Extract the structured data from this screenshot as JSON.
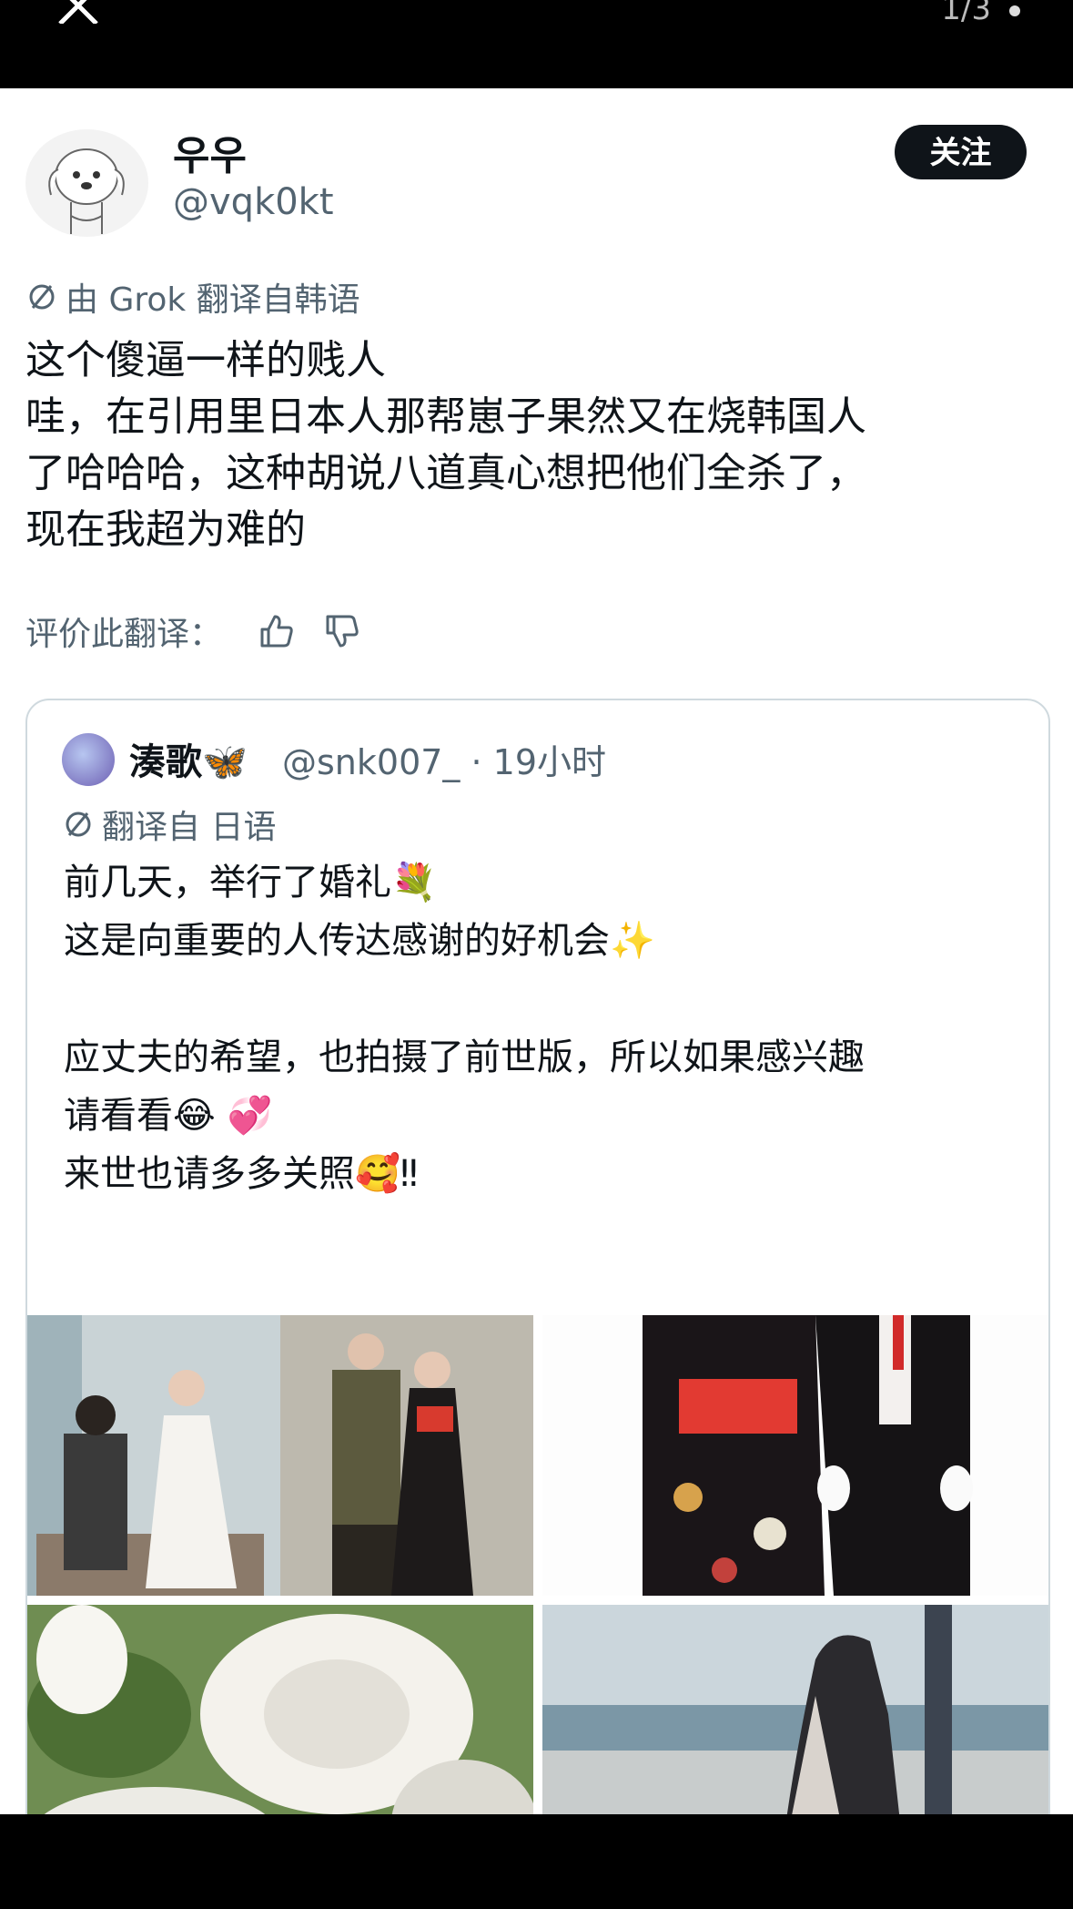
{
  "viewer": {
    "counter": "1/3"
  },
  "author": {
    "display_name": "우우",
    "handle": "@vqk0kt",
    "follow_label": "关注"
  },
  "translation_note": "由 Grok 翻译自韩语",
  "post_lines": [
    "这个傻逼一样的贱人",
    "哇，在引用里日本人那帮崽子果然又在烧韩国人",
    "了哈哈哈，这种胡说八道真心想把他们全杀了，",
    "现在我超为难的"
  ],
  "rate_label": "评价此翻译：",
  "quote": {
    "display_name": "湊歌🦋",
    "handle_time": "@snk007_ · 19小时",
    "translation_note": "翻译自 日语",
    "lines": [
      "前几天，举行了婚礼💐",
      "这是向重要的人传达感谢的好机会✨",
      "",
      "应丈夫的希望，也拍摄了前世版，所以如果感兴趣",
      "请看看😂 💞",
      "来世也请多多关照🥰‼"
    ]
  },
  "icons": {
    "close": "close-icon",
    "translate": "translate-icon",
    "thumbs_up": "thumbs-up-icon",
    "thumbs_down": "thumbs-down-icon",
    "more": "more-dot-icon"
  },
  "colors": {
    "text_primary": "#0f1419",
    "text_secondary": "#536471",
    "border": "#cfd9de",
    "follow_bg": "#0f1419"
  }
}
